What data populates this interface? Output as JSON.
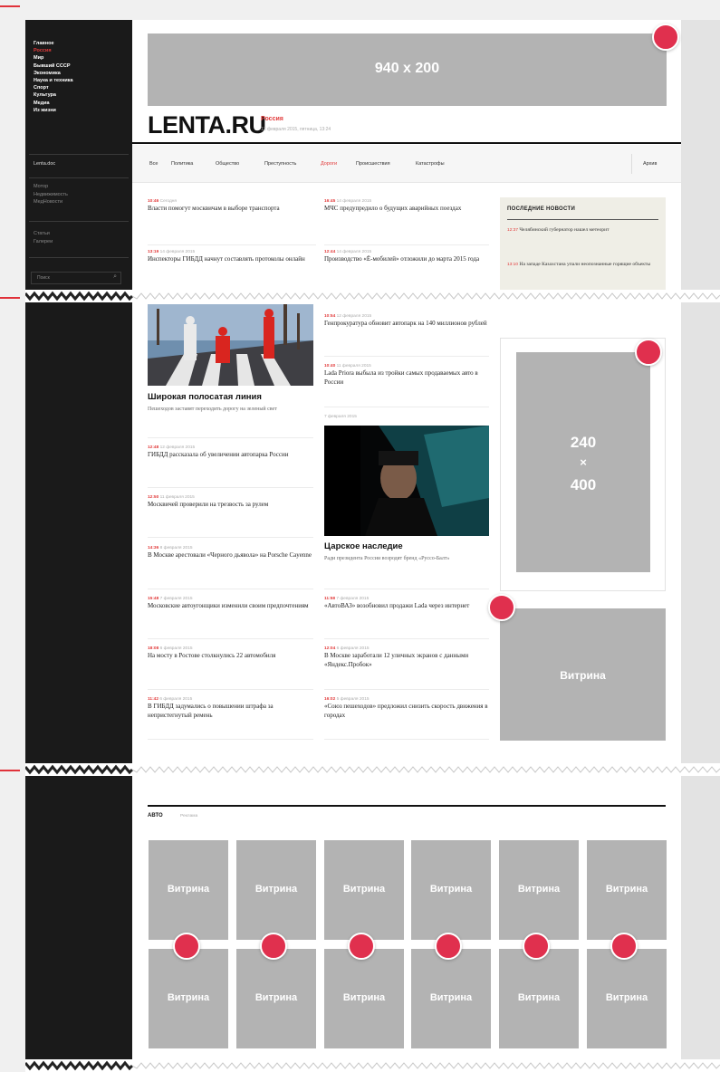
{
  "sidebar": {
    "nav": [
      "Главное",
      "Россия",
      "Мир",
      "Бывший СССР",
      "Экономика",
      "Наука и техника",
      "Спорт",
      "Культура",
      "Медиа",
      "Из жизни"
    ],
    "active_index": 1,
    "extra": "Lenta.doc",
    "sub1": [
      "Мотор",
      "Недвижимость",
      "МедНовости"
    ],
    "sub2": [
      "Статьи",
      "Галереи"
    ],
    "search_placeholder": "Поиск"
  },
  "banner_top": "940 x 200",
  "logo": "LENTA.RU",
  "section": "Россия",
  "date": "13 февраля 2015, пятница, 13:24",
  "subnav": {
    "items": [
      "Все",
      "Политика",
      "Общество",
      "Преступность",
      "Дороги",
      "Происшествия",
      "Катастрофы"
    ],
    "active": "Дороги",
    "archive": "Архив"
  },
  "col1_top": [
    {
      "time": "10:46",
      "date": "Сегодня",
      "title": "Власти помогут москвичам в выборе транспорта"
    },
    {
      "time": "13:19",
      "date": "14 февраля 2015",
      "title": "Инспекторы ГИБДД начнут составлять протоколы онлайн"
    }
  ],
  "col2_top": [
    {
      "time": "16:45",
      "date": "14 февраля 2015",
      "title": "МЧС предупредило о будущих аварийных поездах"
    },
    {
      "time": "12:44",
      "date": "14 февраля 2015",
      "title": "Производство «Ё-мобилей» отложили до марта 2015 года"
    }
  ],
  "latest": {
    "heading": "ПОСЛЕДНИЕ НОВОСТИ",
    "items": [
      {
        "time": "12:37",
        "title": "Челябинский губернатор нашел метеорит"
      },
      {
        "time": "13:10",
        "title": "На западе Казахстана упали неопознанные горящие объекты"
      }
    ]
  },
  "feature1": {
    "title": "Широкая полосатая линия",
    "lead": "Пешеходов заставят переходить дорогу на зеленый свет"
  },
  "col1_bottom": [
    {
      "time": "12:48",
      "date": "12 февраля 2015",
      "title": "ГИБДД рассказала об увеличении автопарка России"
    },
    {
      "time": "12:50",
      "date": "11 февраля 2015",
      "title": "Москвичей проверили на трезвость за рулем"
    },
    {
      "time": "14:36",
      "date": "8 февраля 2015",
      "title": "В Москве арестовали «Черного дьявола» на Porsche Cayenne"
    },
    {
      "time": "15:48",
      "date": "7 февраля 2015",
      "title": "Московские автоугонщики изменили своим предпочтениям"
    },
    {
      "time": "18:08",
      "date": "6 февраля 2015",
      "title": "На мосту в Ростове столкнулись 22 автомобиля"
    },
    {
      "time": "11:42",
      "date": "6 февраля 2015",
      "title": "В ГИБДД задумались о повышении штрафа за непристегнутый ремень"
    }
  ],
  "col2_mid": [
    {
      "time": "10:54",
      "date": "12 февраля 2015",
      "title": "Генпрокуратура обновит автопарк на 140 миллионов рублей"
    },
    {
      "time": "10:40",
      "date": "11 февраля 2015",
      "title": "Lada Priora выбыла из тройки самых продаваемых авто в России"
    }
  ],
  "feature2": {
    "date": "7 февраля 2015",
    "title": "Царское наследие",
    "lead": "Ради президента России возродят бренд «Руссо-Балт»"
  },
  "col2_bottom": [
    {
      "time": "11:58",
      "date": "7 февраля 2015",
      "title": "«АвтоВАЗ» возобновил продажи Lada через интернет"
    },
    {
      "time": "12:04",
      "date": "6 февраля 2015",
      "title": "В Москве заработали 12 уличных экранов с данными «Яндекс.Пробок»"
    },
    {
      "time": "16:02",
      "date": "5 февраля 2015",
      "title": "«Союз пешеходов» предложил снизить скорость движения в городах"
    }
  ],
  "ad_right": {
    "line1": "240",
    "line2": "×",
    "line3": "400"
  },
  "vitrina": "Витрина",
  "auto": {
    "title": "АВТО",
    "sub": "Реклама"
  }
}
